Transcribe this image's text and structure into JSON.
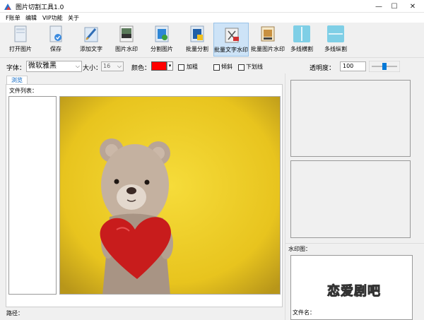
{
  "window": {
    "title": "图片切割工具1.0",
    "controls": {
      "minimize": "—",
      "maximize": "☐",
      "close": "✕"
    }
  },
  "menu": {
    "items": [
      {
        "label": "F账单"
      },
      {
        "label": "编辑"
      },
      {
        "label": "VIP功能"
      },
      {
        "label": "关于"
      }
    ]
  },
  "toolbar": {
    "items": [
      {
        "label": "打开图片",
        "icon": "open-image-icon"
      },
      {
        "label": "保存",
        "icon": "save-icon"
      },
      {
        "label": "添加文字",
        "icon": "add-text-icon"
      },
      {
        "label": "图片水印",
        "icon": "image-watermark-icon"
      },
      {
        "label": "分割图片",
        "icon": "split-image-icon"
      },
      {
        "label": "批量分割",
        "icon": "batch-split-icon"
      },
      {
        "label": "批量文字水印",
        "icon": "batch-text-watermark-icon",
        "active": true
      },
      {
        "label": "批量图片水印",
        "icon": "batch-image-watermark-icon"
      },
      {
        "label": "多线横割",
        "icon": "multi-horizontal-cut-icon"
      },
      {
        "label": "多线纵割",
        "icon": "multi-vertical-cut-icon"
      }
    ]
  },
  "fontbar": {
    "font_label": "字体：",
    "font_value": "微软雅黑",
    "size_label": "大小：",
    "size_value": "16",
    "color_label": "颜色：",
    "color_value": "#ff0000",
    "bold_label": "加粗",
    "italic_label": "倾斜",
    "underline_label": "下划线",
    "opacity_label": "透明度：",
    "opacity_value": "100",
    "opacity_slider_level": 0.5
  },
  "main": {
    "tab_label": "浏览",
    "file_list_label": "文件列表：",
    "path_label": "路径："
  },
  "right": {
    "watermark_label": "水印图：",
    "watermark_text": "恋爱剧吧",
    "filename_label": "文件名："
  },
  "colors": {
    "accent": "#0060c0",
    "preview_bg": "#ffff00",
    "heart": "#d01818"
  }
}
